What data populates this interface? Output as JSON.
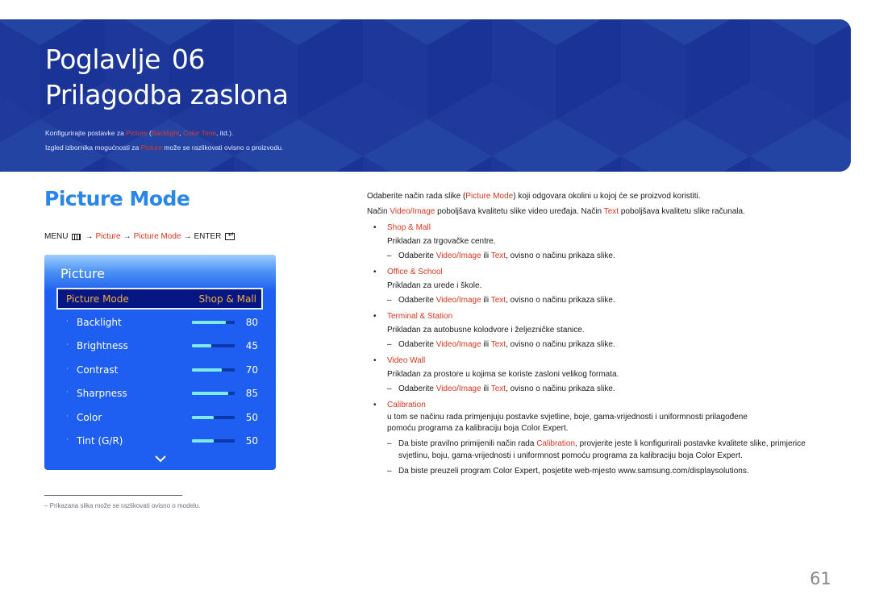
{
  "banner": {
    "chapter_label": "Poglavlje",
    "chapter_number": "06",
    "title": "Prilagodba zaslona",
    "desc_line1": {
      "prefix": "Konfigurirajte postavke za ",
      "picture": "Picture",
      "open": " (",
      "backlight": "Backlight",
      "comma": ", ",
      "color_tone": "Color Tone",
      "suffix": ", itd.)."
    },
    "desc_line2": {
      "prefix": "Izgled izbornika mogućnosti za ",
      "picture": "Picture",
      "suffix": " može se razlikovati ovisno o proizvodu."
    }
  },
  "section": {
    "title": "Picture Mode",
    "menu_path": {
      "menu": "MENU",
      "menu_icon": "menu-grid-icon",
      "arrow": "→",
      "picture": "Picture",
      "picture_mode": "Picture Mode",
      "enter": "ENTER",
      "enter_icon": "enter-icon"
    }
  },
  "osd": {
    "title": "Picture",
    "selected": {
      "label": "Picture Mode",
      "value": "Shop & Mall"
    },
    "items": [
      {
        "label": "Backlight",
        "value": "80",
        "level": 0.8
      },
      {
        "label": "Brightness",
        "value": "45",
        "level": 0.45
      },
      {
        "label": "Contrast",
        "value": "70",
        "level": 0.7
      },
      {
        "label": "Sharpness",
        "value": "85",
        "level": 0.85
      },
      {
        "label": "Color",
        "value": "50",
        "level": 0.5
      },
      {
        "label": "Tint (G/R)",
        "value": "50",
        "level": 0.5
      }
    ],
    "more_icon": "chevron-down-icon",
    "bullet": "·"
  },
  "footnote": "–  Prikazana slika može se razlikovati ovisno o modelu.",
  "content": {
    "intro1": {
      "prefix": "Odaberite način rada slike (",
      "hl": "Picture Mode",
      "suffix": ") koji odgovara okolini u kojoj će se proizvod koristiti."
    },
    "intro2": {
      "p1": "Način ",
      "hl1": "Video/Image",
      "p2": " poboljšava kvalitetu slike video uređaja. Način ",
      "hl2": "Text",
      "p3": " poboljšava kvalitetu slike računala."
    },
    "dash_common": {
      "p1": "Odaberite ",
      "hl1": "Video/Image",
      "p2": " ili ",
      "hl2": "Text",
      "p3": ", ovisno o načinu prikaza slike."
    },
    "modes": [
      {
        "name": "Shop & Mall",
        "desc": "Prikladan za trgovačke centre."
      },
      {
        "name": "Office & School",
        "desc": "Prikladan za urede i škole."
      },
      {
        "name": "Terminal & Station",
        "desc": "Prikladan za autobusne kolodvore i željezničke stanice."
      },
      {
        "name": "Video Wall",
        "desc": "Prikladan za prostore u kojima se koriste zasloni velikog formata."
      }
    ],
    "calibration": {
      "name": "Calibration",
      "desc_line1": "u tom se načinu rada primjenjuju postavke svjetline, boje, gama-vrijednosti i uniformnosti prilagođene",
      "desc_line2": "pomoću programa za kalibraciju boja Color Expert.",
      "note1": {
        "p1": "Da biste pravilno primijenili način rada ",
        "hl": "Calibration",
        "p2": ", provjerite jeste li konfigurirali postavke kvalitete slike, primjerice svjetlinu, boju, gama-vrijednosti i uniformnost pomoću programa za kalibraciju boja Color Expert."
      },
      "note2": "Da biste preuzeli program Color Expert, posjetite web-mjesto www.samsung.com/displaysolutions."
    }
  },
  "page_number": "61",
  "colors": {
    "banner_bg": "#1f3a9c",
    "accent_blue": "#2a86e8",
    "highlight_red": "#d4381f",
    "osd_bg": "#1e5ef0",
    "osd_selected_bg": "#061683",
    "osd_selected_text": "#f0b040",
    "slider_fill": "#7fe9e5"
  }
}
